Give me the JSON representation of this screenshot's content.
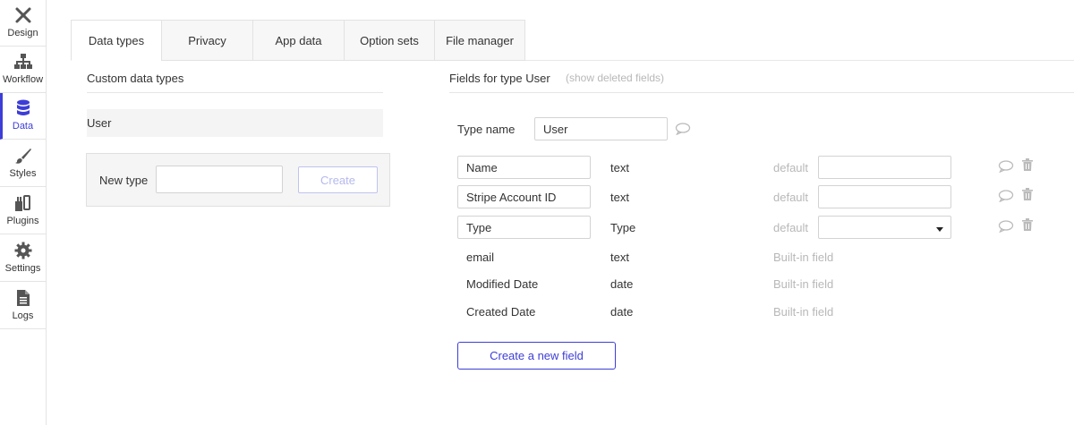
{
  "rail": {
    "items": [
      {
        "label": "Design",
        "icon": "design-icon"
      },
      {
        "label": "Workflow",
        "icon": "workflow-icon"
      },
      {
        "label": "Data",
        "icon": "database-icon"
      },
      {
        "label": "Styles",
        "icon": "brush-icon"
      },
      {
        "label": "Plugins",
        "icon": "plug-icon"
      },
      {
        "label": "Settings",
        "icon": "gear-icon"
      },
      {
        "label": "Logs",
        "icon": "document-icon"
      }
    ],
    "active": "Data"
  },
  "tabs": [
    {
      "label": "Data types",
      "active": true
    },
    {
      "label": "Privacy",
      "active": false
    },
    {
      "label": "App data",
      "active": false
    },
    {
      "label": "Option sets",
      "active": false
    },
    {
      "label": "File manager",
      "active": false
    }
  ],
  "left": {
    "title": "Custom data types",
    "types": [
      "User"
    ],
    "new_type_label": "New type",
    "new_type_value": "",
    "create_label": "Create"
  },
  "right": {
    "title": "Fields for type User",
    "show_deleted": "(show deleted fields)",
    "type_name_label": "Type name",
    "type_name_value": "User",
    "custom_fields": [
      {
        "name": "Name",
        "type": "text",
        "default_label": "default",
        "default_value": "",
        "control": "input"
      },
      {
        "name": "Stripe Account ID",
        "type": "text",
        "default_label": "default",
        "default_value": "",
        "control": "input"
      },
      {
        "name": "Type",
        "type": "Type",
        "default_label": "default",
        "default_value": "",
        "control": "select"
      }
    ],
    "builtin_fields": [
      {
        "name": "email",
        "type": "text",
        "note": "Built-in field"
      },
      {
        "name": "Modified Date",
        "type": "date",
        "note": "Built-in field"
      },
      {
        "name": "Created Date",
        "type": "date",
        "note": "Built-in field"
      }
    ],
    "create_field_label": "Create a new field"
  },
  "colors": {
    "accent": "#3d3dd8",
    "muted_text": "#b8b8b8",
    "panel_bg": "#f5f5f5"
  }
}
